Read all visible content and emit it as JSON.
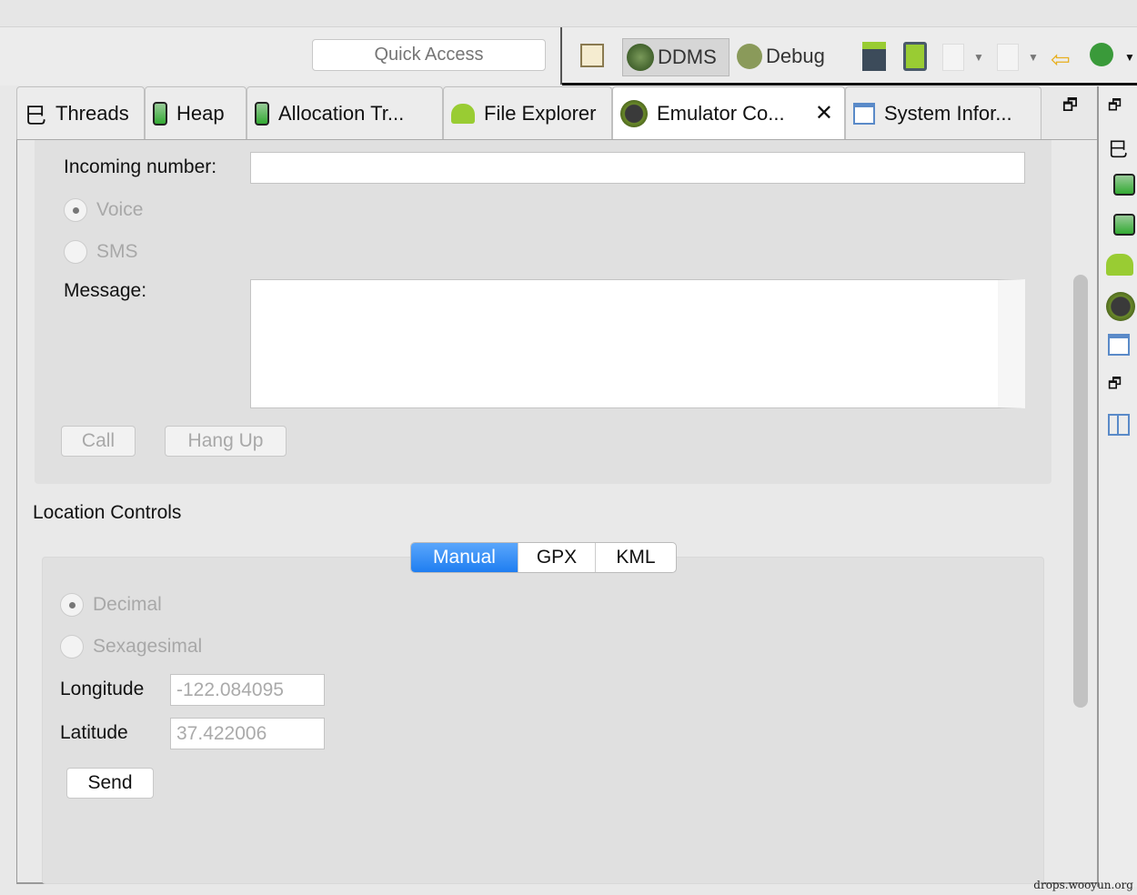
{
  "toolbar": {
    "quick_access_placeholder": "Quick Access",
    "ddms_label": "DDMS",
    "debug_label": "Debug"
  },
  "tabs": [
    {
      "label": "Threads"
    },
    {
      "label": "Heap"
    },
    {
      "label": "Allocation Tr..."
    },
    {
      "label": "File Explorer"
    },
    {
      "label": "Emulator Co...",
      "active": true
    },
    {
      "label": "System Infor..."
    }
  ],
  "telephony": {
    "incoming_label": "Incoming number:",
    "incoming_value": "",
    "voice_label": "Voice",
    "sms_label": "SMS",
    "message_label": "Message:",
    "message_value": "",
    "call_label": "Call",
    "hangup_label": "Hang Up",
    "selected": "Voice"
  },
  "location": {
    "title": "Location Controls",
    "tabs": [
      "Manual",
      "GPX",
      "KML"
    ],
    "selected_tab": "Manual",
    "decimal_label": "Decimal",
    "sexagesimal_label": "Sexagesimal",
    "longitude_label": "Longitude",
    "longitude_value": "-122.084095",
    "latitude_label": "Latitude",
    "latitude_value": "37.422006",
    "send_label": "Send"
  },
  "watermark": "drops.wooyun.org"
}
